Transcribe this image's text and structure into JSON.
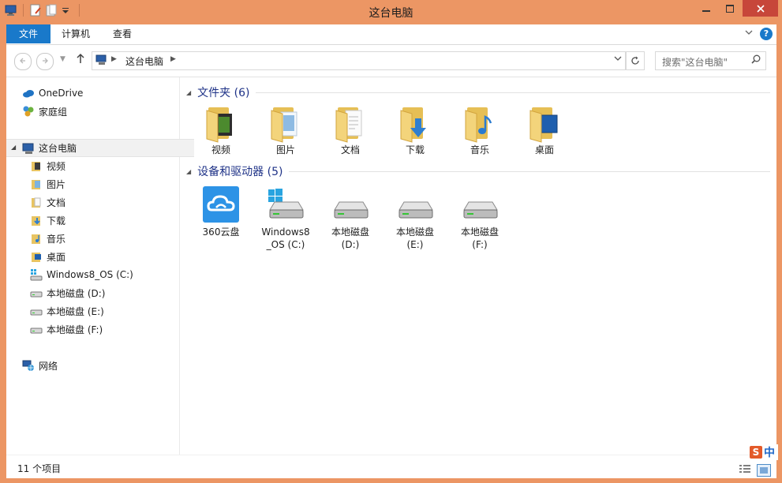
{
  "window": {
    "title": "这台电脑",
    "controls": {
      "minimize": "–",
      "maximize": "□",
      "close": "✕"
    }
  },
  "ribbon": {
    "tabs": [
      {
        "label": "文件",
        "active": true
      },
      {
        "label": "计算机",
        "active": false
      },
      {
        "label": "查看",
        "active": false
      }
    ],
    "help": "?"
  },
  "nav": {
    "breadcrumb": "这台电脑",
    "search_placeholder": "搜索\"这台电脑\""
  },
  "sidebar": {
    "items": [
      {
        "label": "OneDrive",
        "icon": "onedrive-icon"
      },
      {
        "label": "家庭组",
        "icon": "homegroup-icon"
      },
      {
        "label": "这台电脑",
        "icon": "computer-icon",
        "selected": true
      },
      {
        "label": "视频",
        "icon": "videos-folder-icon"
      },
      {
        "label": "图片",
        "icon": "pictures-folder-icon"
      },
      {
        "label": "文档",
        "icon": "documents-folder-icon"
      },
      {
        "label": "下载",
        "icon": "downloads-folder-icon"
      },
      {
        "label": "音乐",
        "icon": "music-folder-icon"
      },
      {
        "label": "桌面",
        "icon": "desktop-folder-icon"
      },
      {
        "label": "Windows8_OS (C:)",
        "icon": "system-drive-icon"
      },
      {
        "label": "本地磁盘 (D:)",
        "icon": "drive-icon"
      },
      {
        "label": "本地磁盘 (E:)",
        "icon": "drive-icon"
      },
      {
        "label": "本地磁盘 (F:)",
        "icon": "drive-icon"
      },
      {
        "label": "网络",
        "icon": "network-icon"
      }
    ]
  },
  "groups": {
    "folders": {
      "title": "文件夹 (6)",
      "items": [
        {
          "label": "视频",
          "icon": "videos-folder-icon",
          "accent": "#3a6a1f"
        },
        {
          "label": "图片",
          "icon": "pictures-folder-icon",
          "accent": "#4a86c4"
        },
        {
          "label": "文档",
          "icon": "documents-folder-icon",
          "accent": "#c9c9c9"
        },
        {
          "label": "下载",
          "icon": "downloads-folder-icon",
          "accent": "#2f7fd0"
        },
        {
          "label": "音乐",
          "icon": "music-folder-icon",
          "accent": "#2a7bd0"
        },
        {
          "label": "桌面",
          "icon": "desktop-folder-icon",
          "accent": "#1f5fae"
        }
      ]
    },
    "devices": {
      "title": "设备和驱动器 (5)",
      "items": [
        {
          "label": "360云盘",
          "icon": "cloud-drive-icon"
        },
        {
          "label": "Windows8_OS (C:)",
          "line1": "Windows8",
          "line2": "_OS (C:)",
          "icon": "system-drive-icon"
        },
        {
          "label": "本地磁盘 (D:)",
          "line1": "本地磁盘",
          "line2": "(D:)",
          "icon": "drive-icon"
        },
        {
          "label": "本地磁盘 (E:)",
          "line1": "本地磁盘",
          "line2": "(E:)",
          "icon": "drive-icon"
        },
        {
          "label": "本地磁盘 (F:)",
          "line1": "本地磁盘",
          "line2": "(F:)",
          "icon": "drive-icon"
        }
      ]
    }
  },
  "status": {
    "item_count": "11 个项目"
  },
  "ime": {
    "s": "S",
    "lang": "中"
  },
  "colors": {
    "frame": "#ec9664",
    "ribbon_file_tab": "#1979ca",
    "group_header_text": "#1e3287",
    "close_button": "#c7463a"
  }
}
